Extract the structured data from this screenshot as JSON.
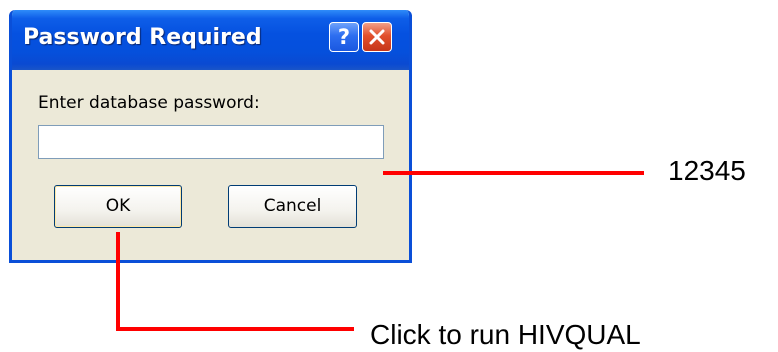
{
  "dialog": {
    "title": "Password Required",
    "help_glyph": "?",
    "prompt": "Enter database password:",
    "password_value": "",
    "ok_label": "OK",
    "cancel_label": "Cancel"
  },
  "annotations": {
    "password_callout": "12345",
    "ok_callout": "Click to run HIVQUAL",
    "line_color": "#ff0000"
  },
  "colors": {
    "titlebar": "#0551e0",
    "dialog_bg": "#ece9d8",
    "close_button": "#e2502c"
  }
}
